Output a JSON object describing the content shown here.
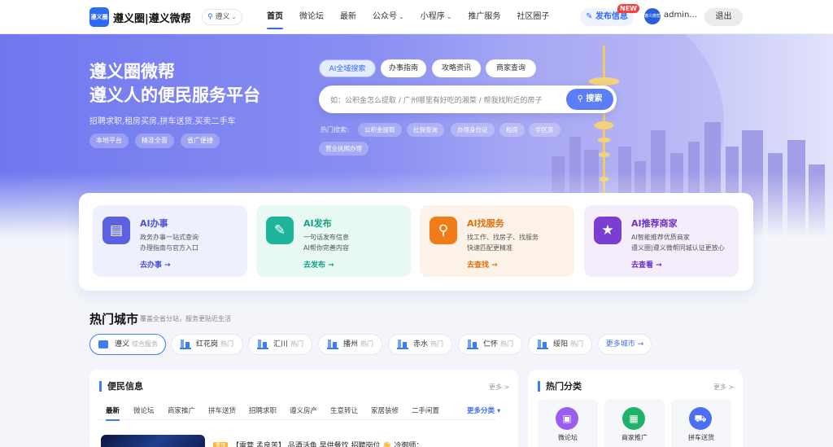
{
  "header": {
    "logo_text": "遵义圈",
    "site_name": "遵义圈|遵义微帮",
    "city": "遵义",
    "nav": [
      {
        "label": "首页",
        "active": true,
        "dropdown": false
      },
      {
        "label": "微论坛",
        "dropdown": false
      },
      {
        "label": "最新",
        "dropdown": false
      },
      {
        "label": "公众号",
        "dropdown": true
      },
      {
        "label": "小程序",
        "dropdown": true
      },
      {
        "label": "推广服务",
        "dropdown": false
      },
      {
        "label": "社区圈子",
        "dropdown": false
      }
    ],
    "publish_label": "发布信息",
    "new_badge": "NEW",
    "avatar_text": "遵义微帮",
    "user_name": "admin...",
    "logout_label": "退出"
  },
  "hero": {
    "title_line1": "遵义圈微帮",
    "title_line2": "遵义人的便民服务平台",
    "subtitle": "招聘求职,租房买房,拼车送货,买卖二手车",
    "tags": [
      "本地平台",
      "精准全面",
      "省广便捷"
    ],
    "search_tabs": [
      "AI全域搜索",
      "办事指南",
      "攻略资讯",
      "商家查询"
    ],
    "search_placeholder": "如：公积金怎么提取 / 广州哪里有好吃的湘菜 / 帮我找附近的房子",
    "search_button": "搜索",
    "hot_label": "热门搜索:",
    "hot_searches": [
      "公积金提取",
      "社保查询",
      "办理身份证",
      "租房",
      "学区房",
      "营业执照办理"
    ]
  },
  "services": [
    {
      "title": "AI办事",
      "desc1": "政务办事一站式查询",
      "desc2": "办理指南与官方入口",
      "link": "去办事 →",
      "color": "#5b61e0",
      "icon": "document-edit-icon"
    },
    {
      "title": "AI发布",
      "desc1": "一句话发布信息",
      "desc2": "AI帮你完善内容",
      "link": "去发布 →",
      "color": "#1fb59a",
      "icon": "edit-icon"
    },
    {
      "title": "AI找服务",
      "desc1": "找工作、找房子、找服务",
      "desc2": "快速匹配更精准",
      "link": "去查找 →",
      "color": "#f07d1a",
      "icon": "search-icon"
    },
    {
      "title": "AI推荐商家",
      "desc1": "AI智能推荐优质商家",
      "desc2": "遵义圈|遵义微帮同城认证更放心",
      "link": "去查看 →",
      "color": "#7a3fd0",
      "icon": "star-icon"
    }
  ],
  "hot_cities": {
    "title": "热门城市",
    "subtitle": "覆盖全省分站，服务更贴近生活",
    "cities": [
      {
        "name": "遵义",
        "tag": "综合服务",
        "active": true
      },
      {
        "name": "红花岗",
        "tag": "热门"
      },
      {
        "name": "汇川",
        "tag": "热门"
      },
      {
        "name": "播州",
        "tag": "热门"
      },
      {
        "name": "赤水",
        "tag": "热门"
      },
      {
        "name": "仁怀",
        "tag": "热门"
      },
      {
        "name": "绥阳",
        "tag": "热门"
      }
    ],
    "more_label": "更多城市 →"
  },
  "info_panel": {
    "title": "便民信息",
    "more": "更多 >",
    "tabs": [
      "最新",
      "微论坛",
      "商家推广",
      "拼车送货",
      "招聘求职",
      "遵义房产",
      "生意转让",
      "家居装修",
      "二手闲置"
    ],
    "more_tab": "更多分类 ▾",
    "top_tag": "置顶",
    "first_post": "【雷营 孟良苦】 品酒活鱼 早供餐饮 招聘岗位 👋 冷御师："
  },
  "category_panel": {
    "title": "热门分类",
    "more": "更多 >",
    "items": [
      {
        "label": "微论坛",
        "color": "#9b5cf0",
        "icon": "forum-icon"
      },
      {
        "label": "商家推广",
        "color": "#1fb36a",
        "icon": "ad-icon"
      },
      {
        "label": "拼车送货",
        "color": "#4a6ff0",
        "icon": "car-icon"
      }
    ]
  }
}
